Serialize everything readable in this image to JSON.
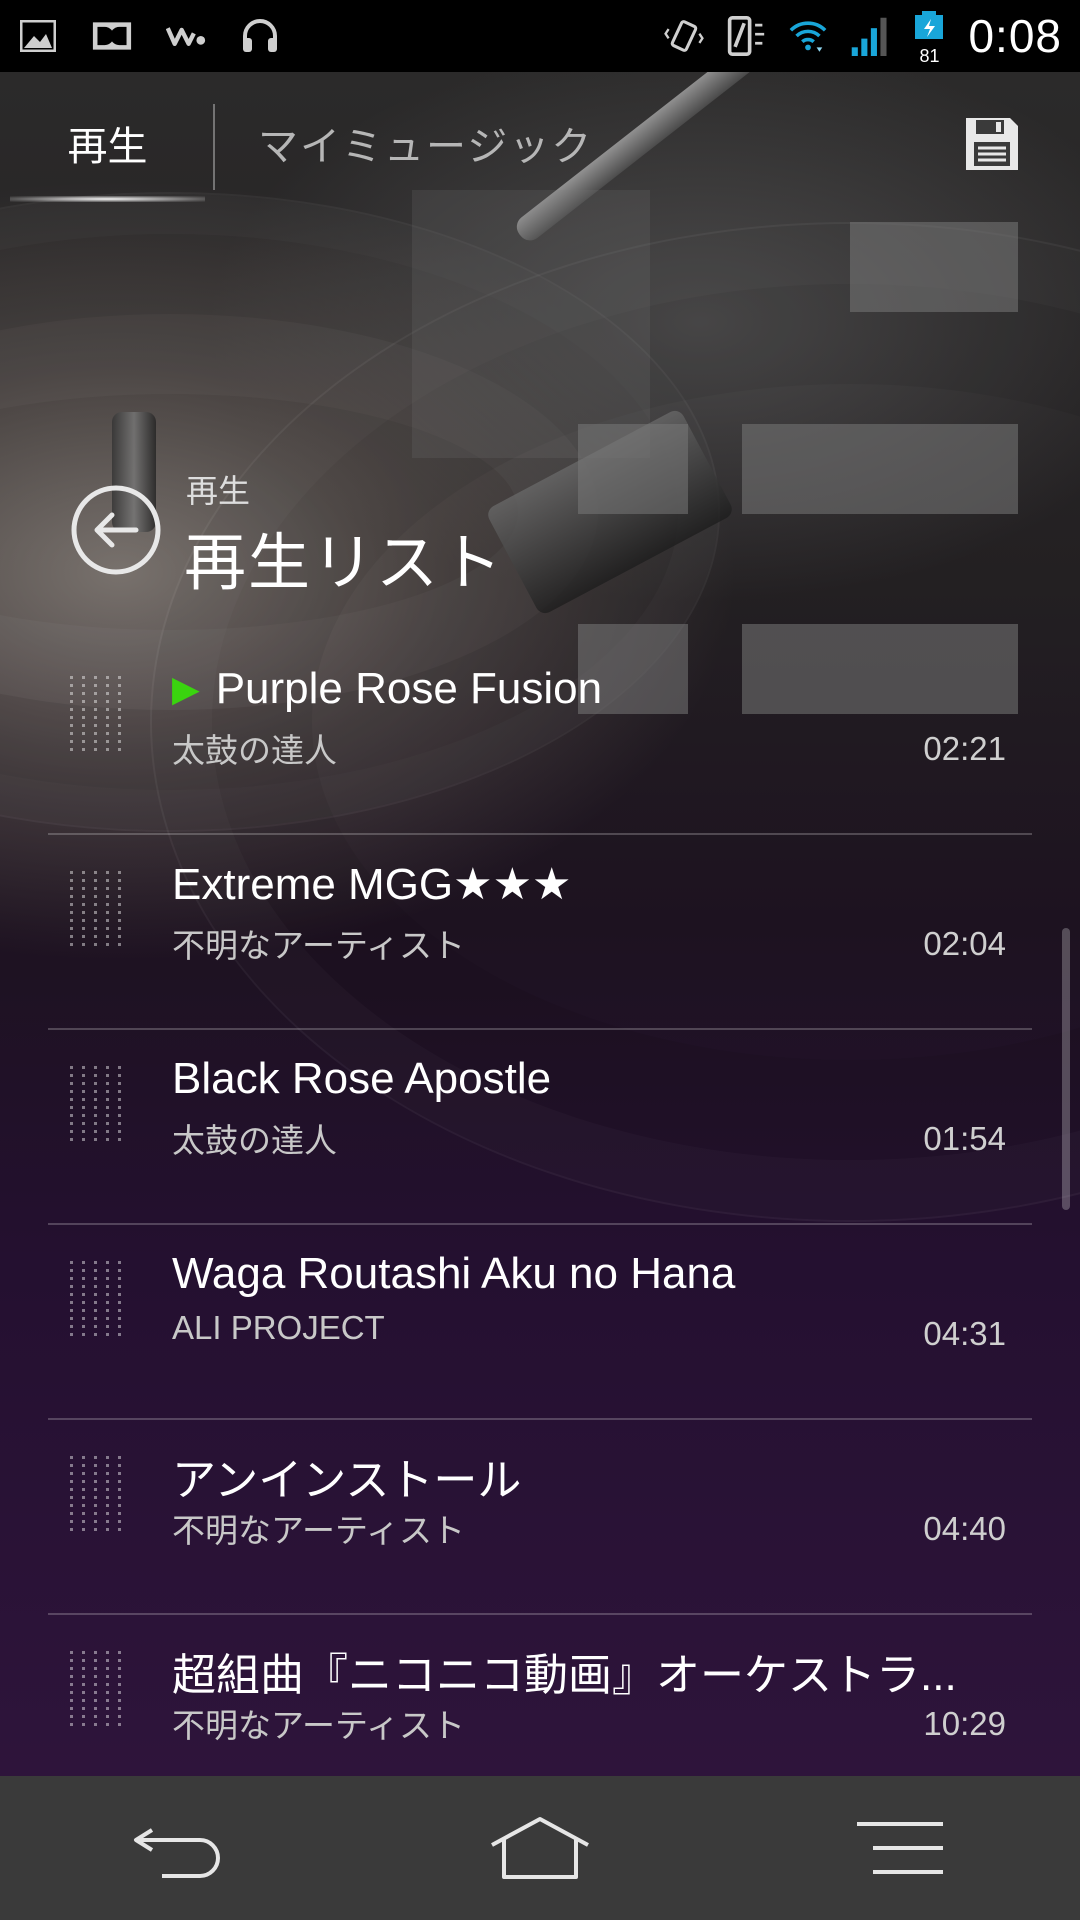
{
  "status_bar": {
    "left_icons": [
      "gallery-icon",
      "dolby-icon",
      "walkman-icon",
      "headphones-icon"
    ],
    "right_icons": [
      "vibrate-icon",
      "nfc-icon",
      "wifi-icon",
      "signal-icon",
      "battery-icon"
    ],
    "battery_level": "81",
    "time": "0:08"
  },
  "tabs": {
    "play_label": "再生",
    "my_music_label": "マイミュージック",
    "save_icon": "save-icon"
  },
  "header": {
    "subtitle": "再生",
    "title": "再生リスト"
  },
  "playlist": [
    {
      "title": "Purple Rose Fusion",
      "artist": "太鼓の達人",
      "duration": "02:21",
      "playing": true
    },
    {
      "title": "Extreme MGG★★★",
      "artist": "不明なアーティスト",
      "duration": "02:04",
      "playing": false
    },
    {
      "title": "Black Rose Apostle",
      "artist": "太鼓の達人",
      "duration": "01:54",
      "playing": false
    },
    {
      "title": "Waga Routashi Aku no Hana",
      "artist": "ALI PROJECT",
      "duration": "04:31",
      "playing": false
    },
    {
      "title": "アンインストール",
      "artist": "不明なアーティスト",
      "duration": "04:40",
      "playing": false
    },
    {
      "title": "超組曲『ニコニコ動画』オーケストラ...",
      "artist": "不明なアーティスト",
      "duration": "10:29",
      "playing": false
    }
  ],
  "playing_indicator": "▶",
  "nav": {
    "icons": [
      "back-icon",
      "home-icon",
      "menu-icon"
    ]
  },
  "colors": {
    "playing_accent": "#3ad40f",
    "navbar": "#3a3a3a"
  }
}
